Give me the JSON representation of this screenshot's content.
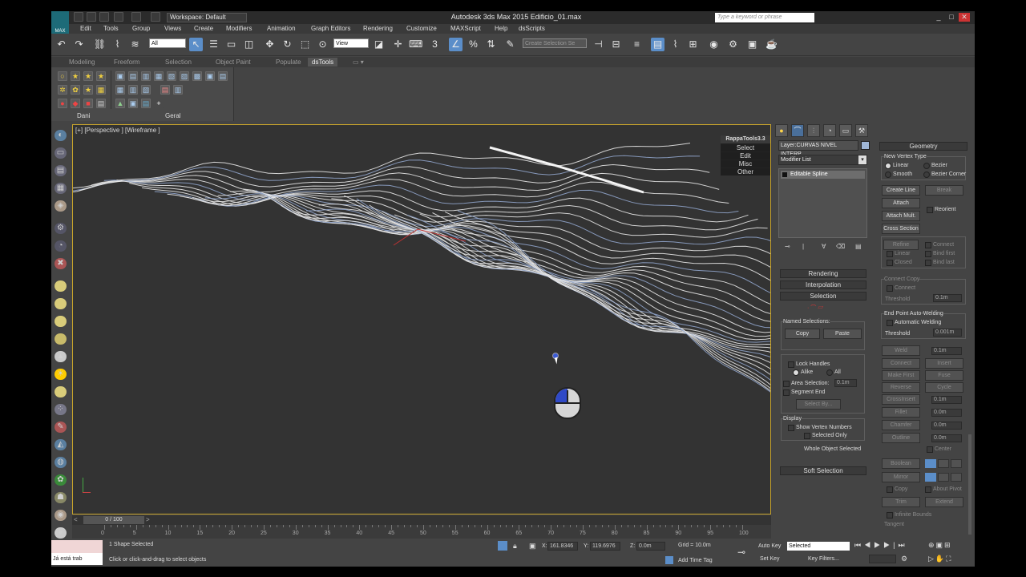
{
  "title_bar": {
    "logo_label": "MAX",
    "workspace": "Workspace: Default",
    "app_title": "Autodesk 3ds Max  2015    Edificio_01.max",
    "search_placeholder": "Type a keyword or phrase"
  },
  "menu": [
    "Edit",
    "Tools",
    "Group",
    "Views",
    "Create",
    "Modifiers",
    "Animation",
    "Graph Editors",
    "Rendering",
    "Customize",
    "MAXScript",
    "Help",
    "dsScripts"
  ],
  "toolbar": {
    "selection_filter": "All",
    "ref_coord": "View",
    "named_selection": "Create Selection Se"
  },
  "ribbon": {
    "tabs": [
      "Modeling",
      "Freeform",
      "Selection",
      "Object Paint",
      "Populate",
      "dsTools"
    ],
    "active_tab": "dsTools",
    "group_labels": [
      "Dani",
      "Geral"
    ]
  },
  "viewport": {
    "label": "[+] [Perspective ] [Wireframe ]",
    "rappa_title": "RappaTools3.3",
    "rappa_items": [
      "Select",
      "Edit",
      "Misc",
      "Other"
    ]
  },
  "command_panel": {
    "object_name": "Layer:CURVAS NIVEL INTERP",
    "object_color": "#a0b7d7",
    "modifier_list": "Modifier List",
    "stack_item": "Editable Spline",
    "rollouts": {
      "rendering": "Rendering",
      "interpolation": "Interpolation",
      "selection": "Selection",
      "soft_selection": "Soft Selection"
    },
    "named_selections_label": "Named Selections:",
    "copy": "Copy",
    "paste": "Paste",
    "lock_handles": "Lock Handles",
    "alike": "Alike",
    "all": "All",
    "area_selection": "Area Selection:",
    "area_value": "0.1m",
    "segment_end": "Segment End",
    "select_by": "Select By...",
    "display_label": "Display",
    "show_vertex_numbers": "Show Vertex Numbers",
    "selected_only": "Selected Only",
    "whole_object_selected": "Whole Object Selected"
  },
  "geometry_panel": {
    "title": "Geometry",
    "new_vertex_type": "New Vertex Type",
    "linear": "Linear",
    "bezier": "Bezier",
    "smooth": "Smooth",
    "bezier_corner": "Bezier Corner",
    "create_line": "Create Line",
    "break": "Break",
    "attach": "Attach",
    "reorient": "Reorient",
    "attach_mult": "Attach Mult.",
    "cross_section": "Cross Section",
    "refine": "Refine",
    "connect": "Connect",
    "linear2": "Linear",
    "bind_first": "Bind first",
    "closed": "Closed",
    "bind_last": "Bind last",
    "connect_copy": "Connect Copy",
    "connect2": "Connect",
    "threshold": "Threshold",
    "threshold_value": "0.1m",
    "end_point_welding": "End Point Auto-Welding",
    "automatic_welding": "Automatic Welding",
    "threshold2_value": "0.001m",
    "weld": "Weld",
    "weld_value": "0.1m",
    "connect3": "Connect",
    "insert": "Insert",
    "make_first": "Make First",
    "fuse": "Fuse",
    "reverse": "Reverse",
    "cycle": "Cycle",
    "crossinsert": "CrossInsert",
    "crossinsert_value": "0.1m",
    "fillet": "Fillet",
    "fillet_value": "0.0m",
    "chamfer": "Chamfer",
    "chamfer_value": "0.0m",
    "outline": "Outline",
    "outline_value": "0.0m",
    "center": "Center",
    "boolean": "Boolean",
    "mirror": "Mirror",
    "copy": "Copy",
    "about_pivot": "About Pivot",
    "trim": "Trim",
    "extend": "Extend",
    "infinite_bounds": "Infinite Bounds",
    "tangent": "Tangent"
  },
  "timeline": {
    "frame": "0 / 100",
    "ticks": [
      "0",
      "5",
      "10",
      "15",
      "20",
      "25",
      "30",
      "35",
      "40",
      "45",
      "50",
      "55",
      "60",
      "65",
      "70",
      "75",
      "80",
      "85",
      "90",
      "95",
      "100"
    ]
  },
  "status": {
    "listener": "Já está trab",
    "selected_info": "1 Shape Selected",
    "prompt": "Click or click-and-drag to select objects",
    "x_label": "X:",
    "x": "161.8346",
    "y_label": "Y:",
    "y": "119.6976",
    "z_label": "Z:",
    "z": "0.0m",
    "grid": "Grid = 10.0m",
    "add_time_tag": "Add Time Tag",
    "auto_key": "Auto Key",
    "selected_dropdown": "Selected",
    "set_key": "Set Key",
    "key_filters": "Key Filters..."
  }
}
